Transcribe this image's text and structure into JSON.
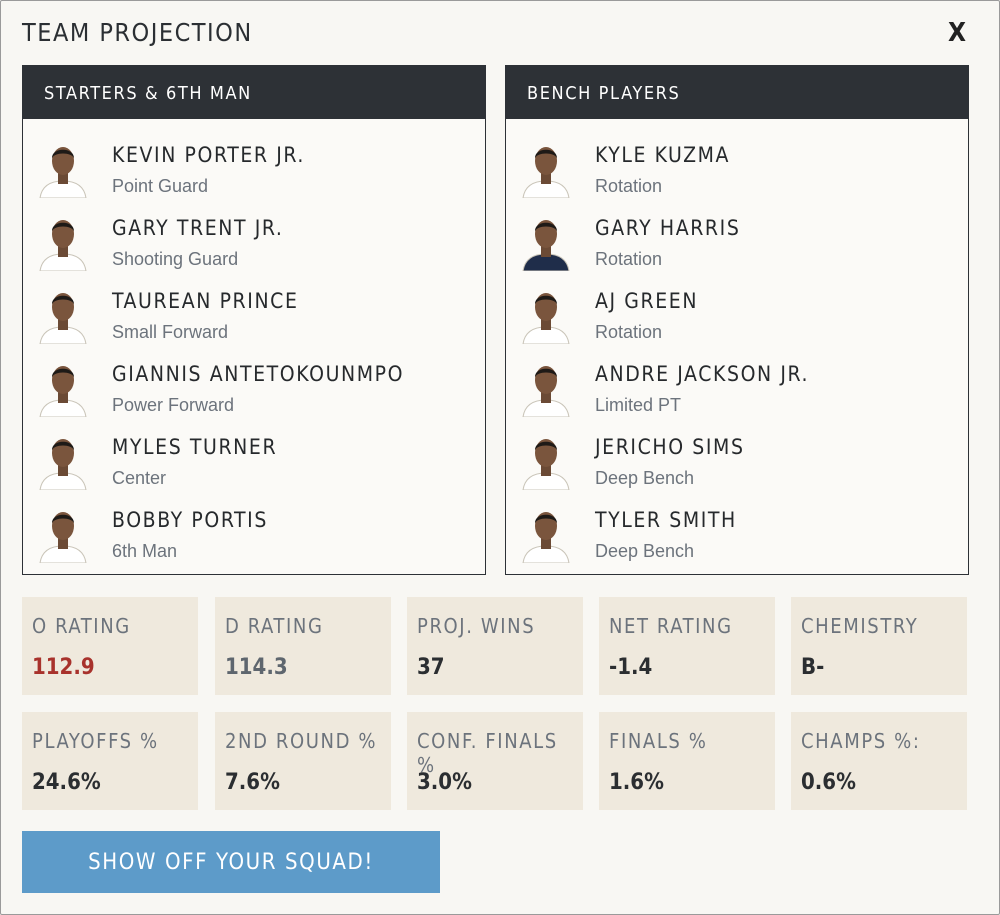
{
  "header": {
    "title": "TEAM PROJECTION",
    "close_label": "X"
  },
  "starters": {
    "heading": "STARTERS & 6TH MAN",
    "players": [
      {
        "name": "KEVIN PORTER JR.",
        "role": "Point Guard",
        "jersey": "#ffffff"
      },
      {
        "name": "GARY TRENT JR.",
        "role": "Shooting Guard",
        "jersey": "#ffffff"
      },
      {
        "name": "TAUREAN PRINCE",
        "role": "Small Forward",
        "jersey": "#ffffff"
      },
      {
        "name": "GIANNIS ANTETOKOUNMPO",
        "role": "Power Forward",
        "jersey": "#ffffff"
      },
      {
        "name": "MYLES TURNER",
        "role": "Center",
        "jersey": "#ffffff"
      },
      {
        "name": "BOBBY PORTIS",
        "role": "6th Man",
        "jersey": "#ffffff"
      }
    ]
  },
  "bench": {
    "heading": "BENCH PLAYERS",
    "players": [
      {
        "name": "KYLE KUZMA",
        "role": "Rotation",
        "jersey": "#ffffff"
      },
      {
        "name": "GARY HARRIS",
        "role": "Rotation",
        "jersey": "#1f2d4a"
      },
      {
        "name": "AJ GREEN",
        "role": "Rotation",
        "jersey": "#ffffff"
      },
      {
        "name": "ANDRE JACKSON JR.",
        "role": "Limited PT",
        "jersey": "#ffffff"
      },
      {
        "name": "JERICHO SIMS",
        "role": "Deep Bench",
        "jersey": "#ffffff"
      },
      {
        "name": "TYLER SMITH",
        "role": "Deep Bench",
        "jersey": "#ffffff"
      }
    ]
  },
  "stats": {
    "o_rating": {
      "label": "O RATING",
      "value": "112.9"
    },
    "d_rating": {
      "label": "D RATING",
      "value": "114.3"
    },
    "proj_wins": {
      "label": "PROJ. WINS",
      "value": "37"
    },
    "net_rating": {
      "label": "NET RATING",
      "value": "-1.4"
    },
    "chemistry": {
      "label": "CHEMISTRY",
      "value": "B-"
    },
    "playoffs": {
      "label": "PLAYOFFS %",
      "value": "24.6%"
    },
    "second_round": {
      "label": "2ND ROUND %",
      "value": "7.6%"
    },
    "conf_finals": {
      "label": "CONF. FINALS %",
      "value": "3.0%"
    },
    "finals": {
      "label": "FINALS %",
      "value": "1.6%"
    },
    "champs": {
      "label": "CHAMPS %:",
      "value": "0.6%"
    }
  },
  "cta": {
    "label": "SHOW OFF YOUR SQUAD!"
  },
  "colors": {
    "background": "#f8f7f3",
    "panel_header": "#2d3136",
    "stat_tile": "#efe9dd",
    "accent_red": "#a8322c",
    "button": "#5d9bc9"
  }
}
